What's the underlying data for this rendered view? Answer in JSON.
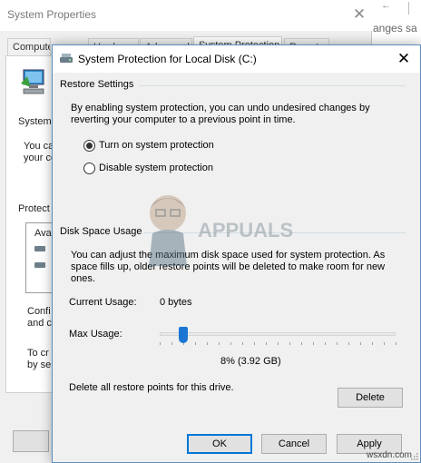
{
  "background_window": {
    "title": "System Properties",
    "close_label": "✕",
    "tabs": [
      "Computer Name",
      "Hardware",
      "Advanced",
      "System Protection",
      "Remote"
    ],
    "fragments": {
      "system": "System",
      "you_ca": "You ca",
      "your_co": "your co",
      "protect": "Protect",
      "ava": "Ava",
      "confi": "Confi",
      "and_c": "and c",
      "to_cr": "To cr",
      "by_se": "by se"
    }
  },
  "right_window": {
    "text_fragment": "anges sa"
  },
  "dialog": {
    "title": "System Protection for Local Disk (C:)",
    "close_label": "✕",
    "restore_settings": {
      "heading": "Restore Settings",
      "description": "By enabling system protection, you can undo undesired changes by reverting your computer to a previous point in time.",
      "options": [
        {
          "label": "Turn on system protection",
          "checked": true
        },
        {
          "label": "Disable system protection",
          "checked": false
        }
      ]
    },
    "disk_space": {
      "heading": "Disk Space Usage",
      "description": "You can adjust the maximum disk space used for system protection. As space fills up, older restore points will be deleted to make room for new ones.",
      "current_usage_label": "Current Usage:",
      "current_usage_value": "0 bytes",
      "max_usage_label": "Max Usage:",
      "max_usage_fraction": 0.08,
      "max_usage_value": "8% (3.92 GB)",
      "delete_text": "Delete all restore points for this drive.",
      "delete_button": "Delete"
    },
    "buttons": {
      "ok": "OK",
      "cancel": "Cancel",
      "apply": "Apply"
    }
  },
  "watermark": {
    "brand": "APPUALS",
    "site": "wsxdn.com"
  },
  "colors": {
    "accent": "#0078d7",
    "slider_thumb": "#1a76d2"
  }
}
